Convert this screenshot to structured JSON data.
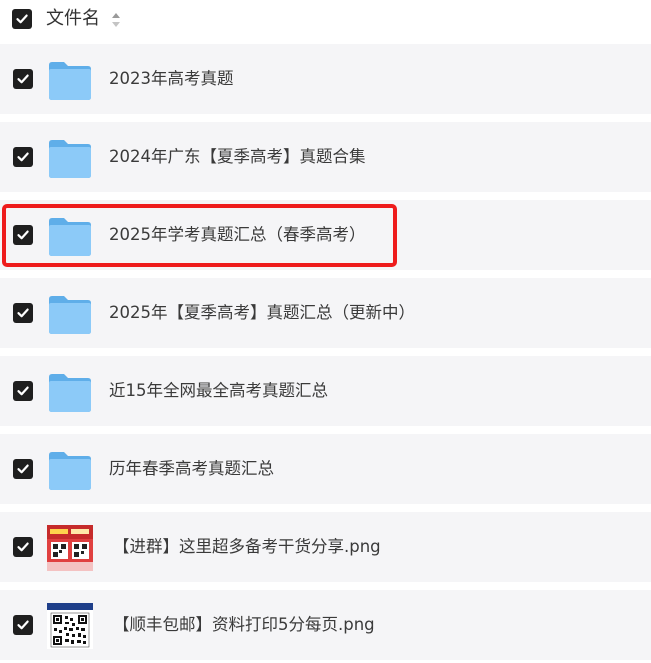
{
  "header": {
    "label": "文件名",
    "checked": true
  },
  "items": [
    {
      "name": "2023年高考真题",
      "type": "folder",
      "checked": true
    },
    {
      "name": "2024年广东【夏季高考】真题合集",
      "type": "folder",
      "checked": true
    },
    {
      "name": "2025年学考真题汇总（春季高考）",
      "type": "folder",
      "checked": true,
      "highlighted": true
    },
    {
      "name": "2025年【夏季高考】真题汇总（更新中）",
      "type": "folder",
      "checked": true
    },
    {
      "name": "近15年全网最全高考真题汇总",
      "type": "folder",
      "checked": true
    },
    {
      "name": "历年春季高考真题汇总",
      "type": "folder",
      "checked": true
    },
    {
      "name": "【进群】这里超多备考干货分享.png",
      "type": "image",
      "checked": true
    },
    {
      "name": "【顺丰包邮】资料打印5分每页.png",
      "type": "image",
      "checked": true
    }
  ],
  "colors": {
    "row_background": "#f5f5f7",
    "checkbox": "#1f1f1f",
    "folder": "#7cc0f6",
    "highlight_border": "#ee1c1c"
  }
}
